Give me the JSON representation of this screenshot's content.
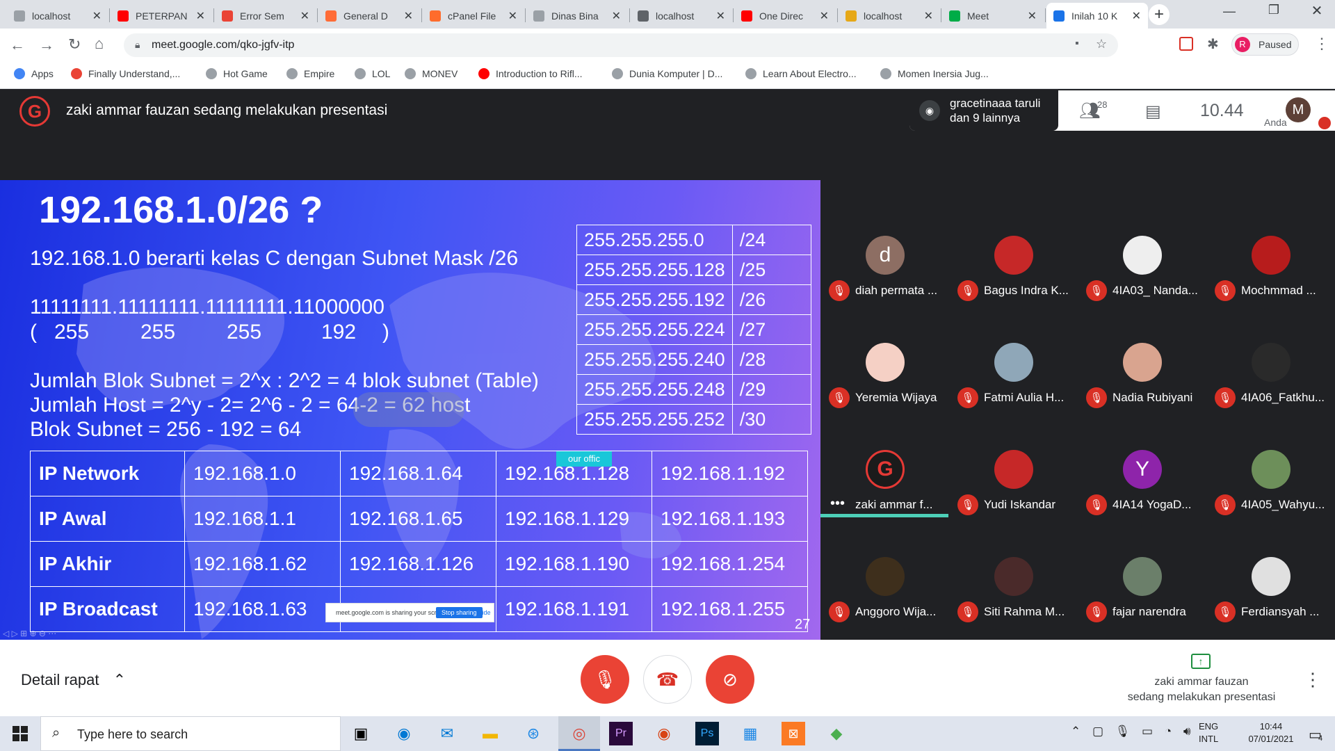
{
  "tabs": [
    {
      "title": "localhost",
      "color": "#9aa0a6"
    },
    {
      "title": "PETERPAN",
      "color": "#ff0000"
    },
    {
      "title": "Error Sem",
      "color": "#ea4335"
    },
    {
      "title": "General D",
      "color": "#ff6c37"
    },
    {
      "title": "cPanel File",
      "color": "#ff6c2c"
    },
    {
      "title": "Dinas Bina",
      "color": "#9aa0a6"
    },
    {
      "title": "localhost",
      "color": "#5f6368"
    },
    {
      "title": "One Direc",
      "color": "#ff0000"
    },
    {
      "title": "localhost",
      "color": "#e6a817"
    },
    {
      "title": "Meet",
      "color": "#00ac47"
    },
    {
      "title": "Inilah 10 K",
      "color": "#1a73e8"
    }
  ],
  "browser": {
    "url": "meet.google.com/qko-jgfv-itp",
    "profile_initial": "R",
    "profile_status": "Paused"
  },
  "bookmarks": [
    {
      "label": "Apps",
      "color": "#4285f4"
    },
    {
      "label": "Finally Understand,...",
      "color": "#ea4335"
    },
    {
      "label": "Hot Game",
      "color": "#9aa0a6"
    },
    {
      "label": "Empire",
      "color": "#9aa0a6"
    },
    {
      "label": "LOL",
      "color": "#9aa0a6"
    },
    {
      "label": "MONEV",
      "color": "#9aa0a6"
    },
    {
      "label": "Introduction to Rifl...",
      "color": "#ff0000"
    },
    {
      "label": "Dunia Komputer | D...",
      "color": "#9aa0a6"
    },
    {
      "label": "Learn About Electro...",
      "color": "#9aa0a6"
    },
    {
      "label": "Momen Inersia Jug...",
      "color": "#9aa0a6"
    }
  ],
  "meet": {
    "presenter_banner": "zaki ammar fauzan sedang melakukan presentasi",
    "speaking": "gracetinaaa taruli dan 9 lainnya",
    "participant_count": "28",
    "time": "10.44",
    "self_initial": "M",
    "self_label": "Anda",
    "details_label": "Detail rapat",
    "presenting_line1": "zaki ammar fauzan",
    "presenting_line2": "sedang melakukan presentasi"
  },
  "slide": {
    "title": "192.168.1.0/26 ?",
    "line1": "192.168.1.0 berarti kelas C dengan Subnet Mask /26",
    "binary": "11111111.11111111.11111111.11000000",
    "decimals": [
      "(",
      "255",
      "255",
      "255",
      "192",
      ")"
    ],
    "blok": "Jumlah Blok Subnet = 2^x : 2^2 = 4 blok subnet (Table)",
    "host": "Jumlah Host = 2^y - 2= 2^6 - 2 = 64-2 = 62 host",
    "blok_subnet": "Blok Subnet = 256 - 192 = 64",
    "page": "27",
    "sharing_note": "meet.google.com is sharing your screen.",
    "stop_sharing": "Stop sharing",
    "hide": "Hide",
    "cursor_tag": "our offic",
    "mask_table": [
      [
        "255.255.255.0",
        "/24"
      ],
      [
        "255.255.255.128",
        "/25"
      ],
      [
        "255.255.255.192",
        "/26"
      ],
      [
        "255.255.255.224",
        "/27"
      ],
      [
        "255.255.255.240",
        "/28"
      ],
      [
        "255.255.255.248",
        "/29"
      ],
      [
        "255.255.255.252",
        "/30"
      ]
    ],
    "ip_table": [
      [
        "IP Network",
        "192.168.1.0",
        "192.168.1.64",
        "192.168.1.128",
        "192.168.1.192"
      ],
      [
        "IP Awal",
        "192.168.1.1",
        "192.168.1.65",
        "192.168.1.129",
        "192.168.1.193"
      ],
      [
        "IP Akhir",
        "192.168.1.62",
        "192.168.1.126",
        "192.168.1.190",
        "192.168.1.254"
      ],
      [
        "IP Broadcast",
        "192.168.1.63",
        "",
        "192.168.1.191",
        "192.168.1.255"
      ]
    ]
  },
  "participants": [
    {
      "name": "diah permata ...",
      "initial": "d",
      "color": "#8d6e63"
    },
    {
      "name": "Bagus Indra K...",
      "initial": "",
      "color": "#c62828"
    },
    {
      "name": "4IA03_ Nanda...",
      "initial": "",
      "color": "#eeeeee"
    },
    {
      "name": "Mochmmad ...",
      "initial": "",
      "color": "#b71c1c"
    },
    {
      "name": "Yeremia Wijaya",
      "initial": "",
      "color": "#f5d0c5"
    },
    {
      "name": "Fatmi Aulia H...",
      "initial": "",
      "color": "#8fa7b8"
    },
    {
      "name": "Nadia Rubiyani",
      "initial": "",
      "color": "#d9a48f"
    },
    {
      "name": "4IA06_Fatkhu...",
      "initial": "",
      "color": "#2a2a2a"
    },
    {
      "name": "zaki ammar f...",
      "initial": "G",
      "color": "#1b1b1b"
    },
    {
      "name": "Yudi Iskandar",
      "initial": "",
      "color": "#c62828"
    },
    {
      "name": "4IA14 YogaD...",
      "initial": "Y",
      "color": "#8e24aa"
    },
    {
      "name": "4IA05_Wahyu...",
      "initial": "",
      "color": "#6d8f5a"
    },
    {
      "name": "Anggoro Wija...",
      "initial": "",
      "color": "#3e2f1c"
    },
    {
      "name": "Siti Rahma M...",
      "initial": "",
      "color": "#4a2a2a"
    },
    {
      "name": "fajar narendra",
      "initial": "",
      "color": "#6b7f6a"
    },
    {
      "name": "Ferdiansyah ...",
      "initial": "",
      "color": "#e0e0e0"
    }
  ],
  "taskbar": {
    "search_placeholder": "Type here to search",
    "lang1": "ENG",
    "lang2": "INTL",
    "time": "10:44",
    "date": "07/01/2021",
    "notif_count": "4"
  }
}
